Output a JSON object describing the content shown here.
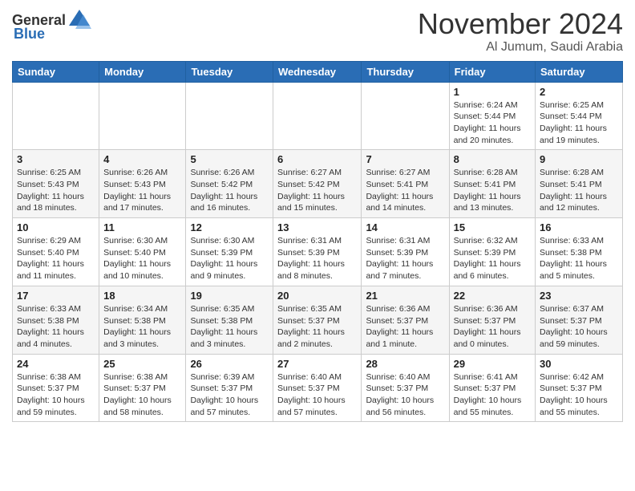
{
  "header": {
    "logo_general": "General",
    "logo_blue": "Blue",
    "month": "November 2024",
    "location": "Al Jumum, Saudi Arabia"
  },
  "weekdays": [
    "Sunday",
    "Monday",
    "Tuesday",
    "Wednesday",
    "Thursday",
    "Friday",
    "Saturday"
  ],
  "weeks": [
    [
      {
        "day": "",
        "info": ""
      },
      {
        "day": "",
        "info": ""
      },
      {
        "day": "",
        "info": ""
      },
      {
        "day": "",
        "info": ""
      },
      {
        "day": "",
        "info": ""
      },
      {
        "day": "1",
        "info": "Sunrise: 6:24 AM\nSunset: 5:44 PM\nDaylight: 11 hours\nand 20 minutes."
      },
      {
        "day": "2",
        "info": "Sunrise: 6:25 AM\nSunset: 5:44 PM\nDaylight: 11 hours\nand 19 minutes."
      }
    ],
    [
      {
        "day": "3",
        "info": "Sunrise: 6:25 AM\nSunset: 5:43 PM\nDaylight: 11 hours\nand 18 minutes."
      },
      {
        "day": "4",
        "info": "Sunrise: 6:26 AM\nSunset: 5:43 PM\nDaylight: 11 hours\nand 17 minutes."
      },
      {
        "day": "5",
        "info": "Sunrise: 6:26 AM\nSunset: 5:42 PM\nDaylight: 11 hours\nand 16 minutes."
      },
      {
        "day": "6",
        "info": "Sunrise: 6:27 AM\nSunset: 5:42 PM\nDaylight: 11 hours\nand 15 minutes."
      },
      {
        "day": "7",
        "info": "Sunrise: 6:27 AM\nSunset: 5:41 PM\nDaylight: 11 hours\nand 14 minutes."
      },
      {
        "day": "8",
        "info": "Sunrise: 6:28 AM\nSunset: 5:41 PM\nDaylight: 11 hours\nand 13 minutes."
      },
      {
        "day": "9",
        "info": "Sunrise: 6:28 AM\nSunset: 5:41 PM\nDaylight: 11 hours\nand 12 minutes."
      }
    ],
    [
      {
        "day": "10",
        "info": "Sunrise: 6:29 AM\nSunset: 5:40 PM\nDaylight: 11 hours\nand 11 minutes."
      },
      {
        "day": "11",
        "info": "Sunrise: 6:30 AM\nSunset: 5:40 PM\nDaylight: 11 hours\nand 10 minutes."
      },
      {
        "day": "12",
        "info": "Sunrise: 6:30 AM\nSunset: 5:39 PM\nDaylight: 11 hours\nand 9 minutes."
      },
      {
        "day": "13",
        "info": "Sunrise: 6:31 AM\nSunset: 5:39 PM\nDaylight: 11 hours\nand 8 minutes."
      },
      {
        "day": "14",
        "info": "Sunrise: 6:31 AM\nSunset: 5:39 PM\nDaylight: 11 hours\nand 7 minutes."
      },
      {
        "day": "15",
        "info": "Sunrise: 6:32 AM\nSunset: 5:39 PM\nDaylight: 11 hours\nand 6 minutes."
      },
      {
        "day": "16",
        "info": "Sunrise: 6:33 AM\nSunset: 5:38 PM\nDaylight: 11 hours\nand 5 minutes."
      }
    ],
    [
      {
        "day": "17",
        "info": "Sunrise: 6:33 AM\nSunset: 5:38 PM\nDaylight: 11 hours\nand 4 minutes."
      },
      {
        "day": "18",
        "info": "Sunrise: 6:34 AM\nSunset: 5:38 PM\nDaylight: 11 hours\nand 3 minutes."
      },
      {
        "day": "19",
        "info": "Sunrise: 6:35 AM\nSunset: 5:38 PM\nDaylight: 11 hours\nand 3 minutes."
      },
      {
        "day": "20",
        "info": "Sunrise: 6:35 AM\nSunset: 5:37 PM\nDaylight: 11 hours\nand 2 minutes."
      },
      {
        "day": "21",
        "info": "Sunrise: 6:36 AM\nSunset: 5:37 PM\nDaylight: 11 hours\nand 1 minute."
      },
      {
        "day": "22",
        "info": "Sunrise: 6:36 AM\nSunset: 5:37 PM\nDaylight: 11 hours\nand 0 minutes."
      },
      {
        "day": "23",
        "info": "Sunrise: 6:37 AM\nSunset: 5:37 PM\nDaylight: 10 hours\nand 59 minutes."
      }
    ],
    [
      {
        "day": "24",
        "info": "Sunrise: 6:38 AM\nSunset: 5:37 PM\nDaylight: 10 hours\nand 59 minutes."
      },
      {
        "day": "25",
        "info": "Sunrise: 6:38 AM\nSunset: 5:37 PM\nDaylight: 10 hours\nand 58 minutes."
      },
      {
        "day": "26",
        "info": "Sunrise: 6:39 AM\nSunset: 5:37 PM\nDaylight: 10 hours\nand 57 minutes."
      },
      {
        "day": "27",
        "info": "Sunrise: 6:40 AM\nSunset: 5:37 PM\nDaylight: 10 hours\nand 57 minutes."
      },
      {
        "day": "28",
        "info": "Sunrise: 6:40 AM\nSunset: 5:37 PM\nDaylight: 10 hours\nand 56 minutes."
      },
      {
        "day": "29",
        "info": "Sunrise: 6:41 AM\nSunset: 5:37 PM\nDaylight: 10 hours\nand 55 minutes."
      },
      {
        "day": "30",
        "info": "Sunrise: 6:42 AM\nSunset: 5:37 PM\nDaylight: 10 hours\nand 55 minutes."
      }
    ]
  ]
}
